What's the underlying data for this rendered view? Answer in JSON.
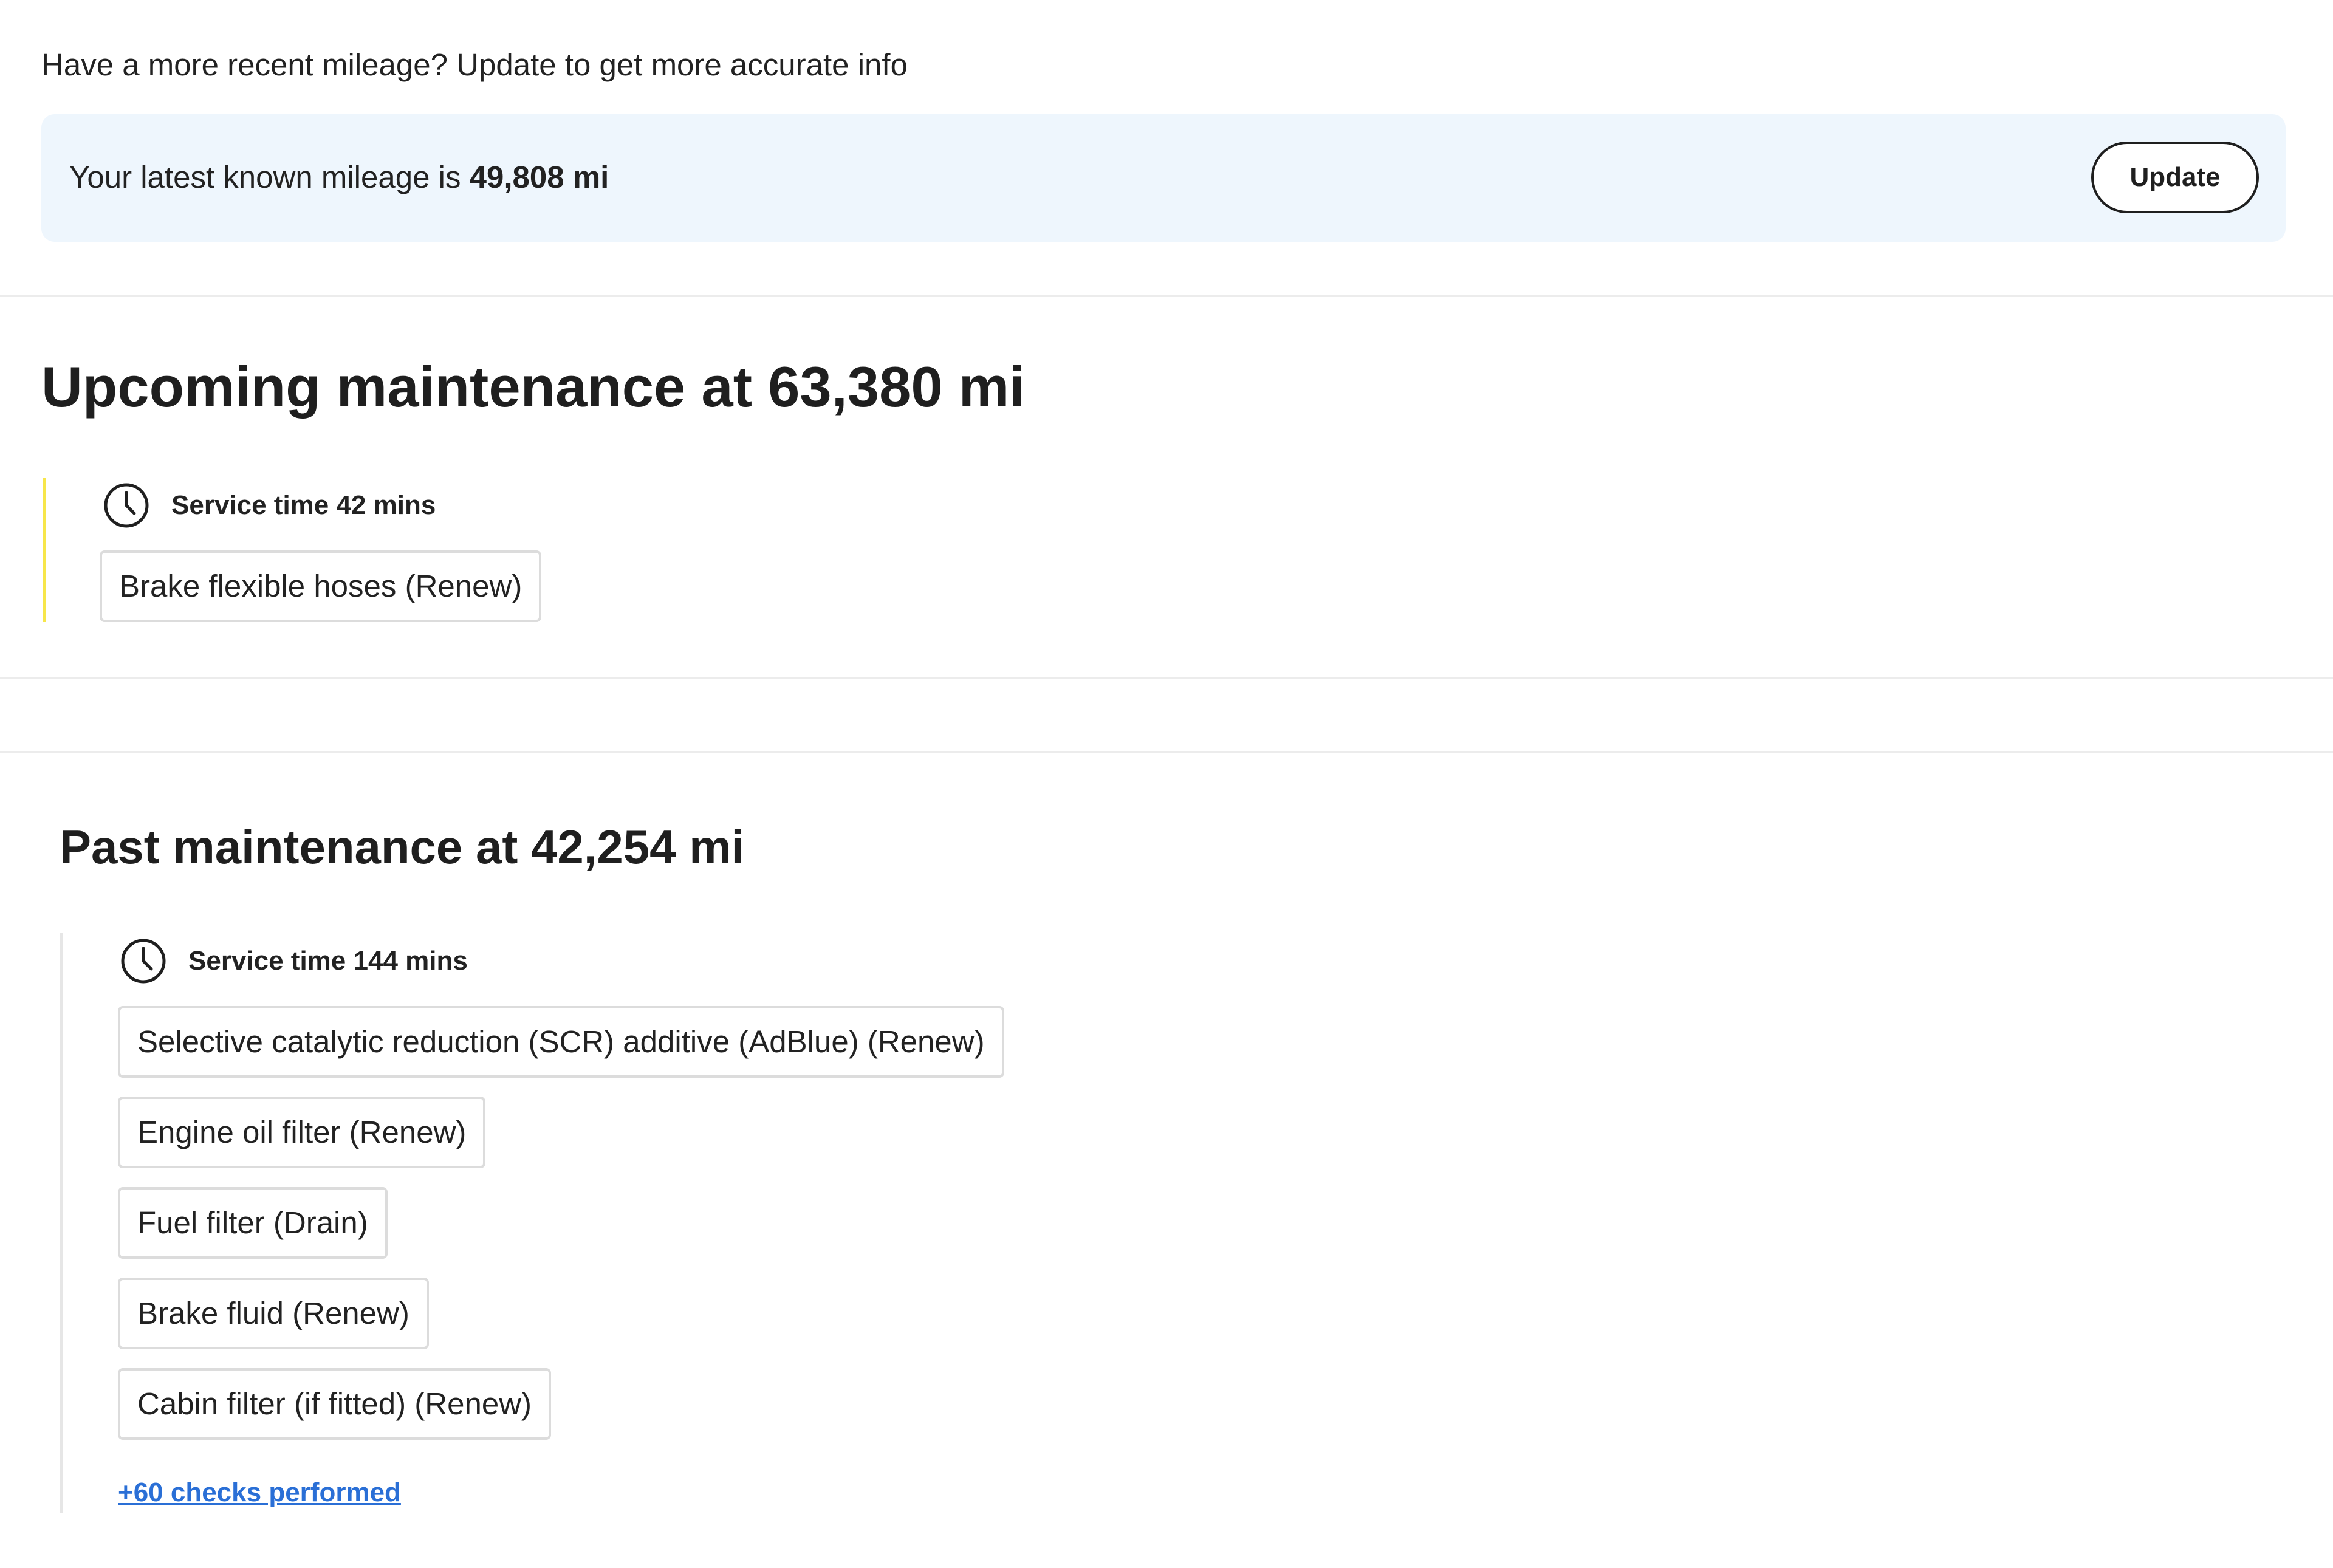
{
  "mileage_prompt": "Have a more recent mileage? Update to get more accurate info",
  "mileage_banner": {
    "text": "Your latest known mileage is",
    "value": "49,808 mi",
    "update_label": "Update"
  },
  "upcoming": {
    "title": "Upcoming maintenance at 63,380 mi",
    "service_time": "Service time 42 mins",
    "accent_color": "#f7e64a",
    "tasks": [
      "Brake flexible hoses (Renew)"
    ]
  },
  "past": {
    "title": "Past maintenance at 42,254 mi",
    "service_time": "Service time 144 mins",
    "accent_color": "#e6e6e6",
    "tasks": [
      "Selective catalytic reduction (SCR) additive (AdBlue) (Renew)",
      "Engine oil filter (Renew)",
      "Fuel filter (Drain)",
      "Brake fluid (Renew)",
      "Cabin filter (if fitted) (Renew)"
    ],
    "checks_link": "+60 checks performed"
  },
  "icons": {
    "service_time": "clock-icon"
  },
  "colors": {
    "banner_background": "#eef6fd",
    "link": "#2a6fd6"
  }
}
